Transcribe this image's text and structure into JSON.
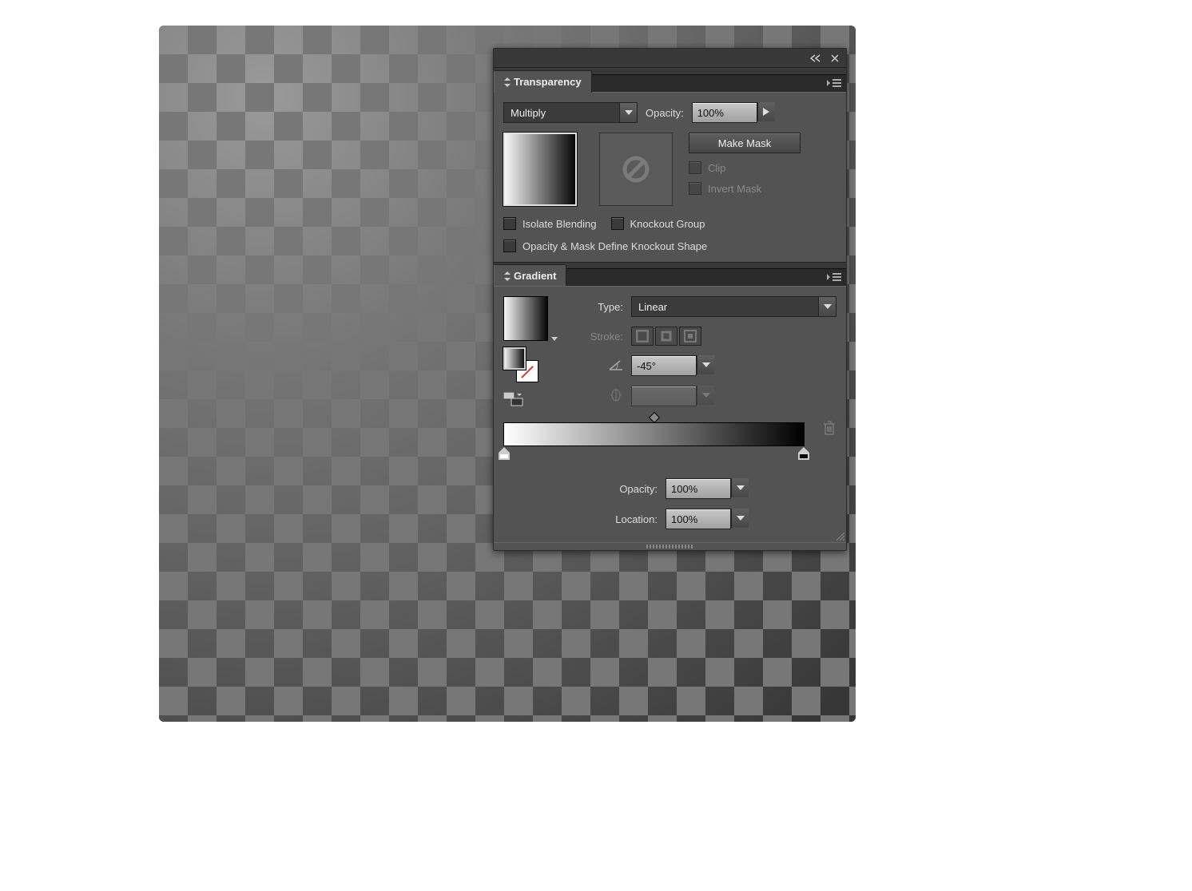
{
  "panel_titles": {
    "transparency": "Transparency",
    "gradient": "Gradient"
  },
  "transparency": {
    "blend_mode": "Multiply",
    "opacity_label": "Opacity:",
    "opacity_value": "100%",
    "make_mask": "Make Mask",
    "clip": "Clip",
    "invert_mask": "Invert Mask",
    "isolate_blending": "Isolate Blending",
    "knockout_group": "Knockout Group",
    "opacity_mask_define": "Opacity & Mask Define Knockout Shape"
  },
  "gradient": {
    "type_label": "Type:",
    "type_value": "Linear",
    "stroke_label": "Stroke:",
    "angle_value": "-45°",
    "aspect_value": "",
    "stop_opacity_label": "Opacity:",
    "stop_opacity_value": "100%",
    "stop_location_label": "Location:",
    "stop_location_value": "100%",
    "stops": [
      {
        "position_pct": 0,
        "color": "#ffffff"
      },
      {
        "position_pct": 100,
        "color": "#000000"
      }
    ],
    "midpoint_pct": 50
  }
}
